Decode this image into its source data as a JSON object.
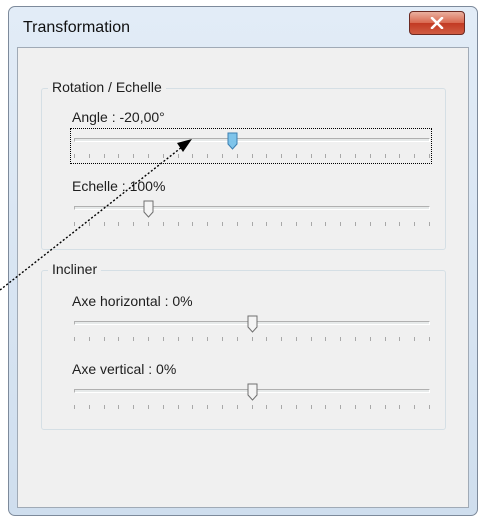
{
  "window": {
    "title": "Transformation",
    "close_icon": "close-x-icon"
  },
  "rotation_group": {
    "title": "Rotation / Echelle",
    "angle": {
      "label": "Angle : -20,00°",
      "value": -20.0,
      "min": -180,
      "max": 180
    },
    "scale": {
      "label": "Echelle : 100%",
      "value": 100,
      "min": 0,
      "max": 500
    }
  },
  "skew_group": {
    "title": "Incliner",
    "horizontal": {
      "label": "Axe horizontal : 0%",
      "value": 0,
      "min": -100,
      "max": 100
    },
    "vertical": {
      "label": "Axe vertical : 0%",
      "value": 0,
      "min": -100,
      "max": 100
    }
  },
  "colors": {
    "selected_thumb": "#7fc4ea",
    "thumb": "#f4f4f4",
    "close_button": "#c7432b"
  },
  "annotation": {
    "icon": "dotted-arrow-icon"
  }
}
